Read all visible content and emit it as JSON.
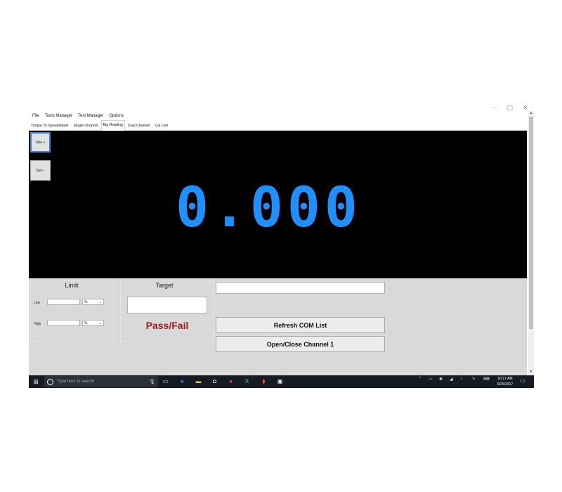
{
  "window": {
    "controls": [
      "–",
      "▢",
      "✕"
    ]
  },
  "menu": [
    "File",
    "Tools Manager",
    "Test Manager",
    "Options"
  ],
  "tabs": [
    {
      "label": "Torque To Spreadsheet",
      "active": false
    },
    {
      "label": "Single Channel",
      "active": false
    },
    {
      "label": "Big Reading",
      "active": true
    },
    {
      "label": "Dual Channel",
      "active": false
    },
    {
      "label": "Cal Cert",
      "active": false
    }
  ],
  "display": {
    "size_up_label": "Size +",
    "size_down_label": "Size -",
    "reading": "0.000",
    "reading_color": "#1e90ff"
  },
  "limit": {
    "title": "Limit",
    "low_label": "Low",
    "low_value": "",
    "low_unit": "%",
    "high_label": "High",
    "high_value": "",
    "high_unit": "%"
  },
  "target": {
    "title": "Target",
    "value": "",
    "status": "Pass/Fail",
    "status_color": "#9b1c1c"
  },
  "com": {
    "port_value": "",
    "refresh_label": "Refresh COM List",
    "open_close_label": "Open/Close Channel 1"
  },
  "taskbar": {
    "search_placeholder": "Type here to search",
    "time": "10:17 AM",
    "date": "9/25/2017",
    "apps": [
      "task-view-icon",
      "edge-icon",
      "file-explorer-icon",
      "store-icon",
      "chrome-icon",
      "excel-icon",
      "acrobat-icon",
      "app-icon"
    ]
  }
}
